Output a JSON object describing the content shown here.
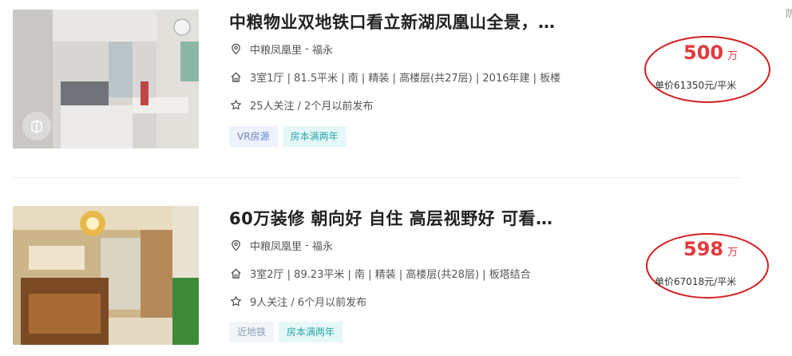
{
  "listings": [
    {
      "title": "中粮物业双地铁口看立新湖凤凰山全景，…",
      "community": "中粮凤凰里",
      "community_sep": " - ",
      "district": "福永",
      "specs": "3室1厅 | 81.5平米 | 南 | 精装 | 高楼层(共27层) | 2016年建 | 板楼",
      "follow": "25人关注 / 2个月以前发布",
      "tags": [
        "VR房源",
        "房本满两年"
      ],
      "price": "500",
      "price_unit": "万",
      "unit_price": "单价61350元/平米"
    },
    {
      "title": "60万装修 朝向好 自住 高层视野好 可看…",
      "community": "中粮凤凰里",
      "community_sep": " - ",
      "district": "福永",
      "specs": "3室2厅 | 89.23平米 | 南 | 精装 | 高楼层(共28层) | 板塔结合",
      "follow": "9人关注 / 6个月以前发布",
      "tags": [
        "近地铁",
        "房本满两年"
      ],
      "price": "598",
      "price_unit": "万",
      "unit_price": "单价67018元/平米"
    }
  ],
  "edge_text": "防",
  "colors": {
    "price": "#e4393c",
    "annotation_circle": "#d42020"
  },
  "icons": [
    "location-pin-icon",
    "house-icon",
    "star-icon",
    "vr-badge-icon"
  ]
}
